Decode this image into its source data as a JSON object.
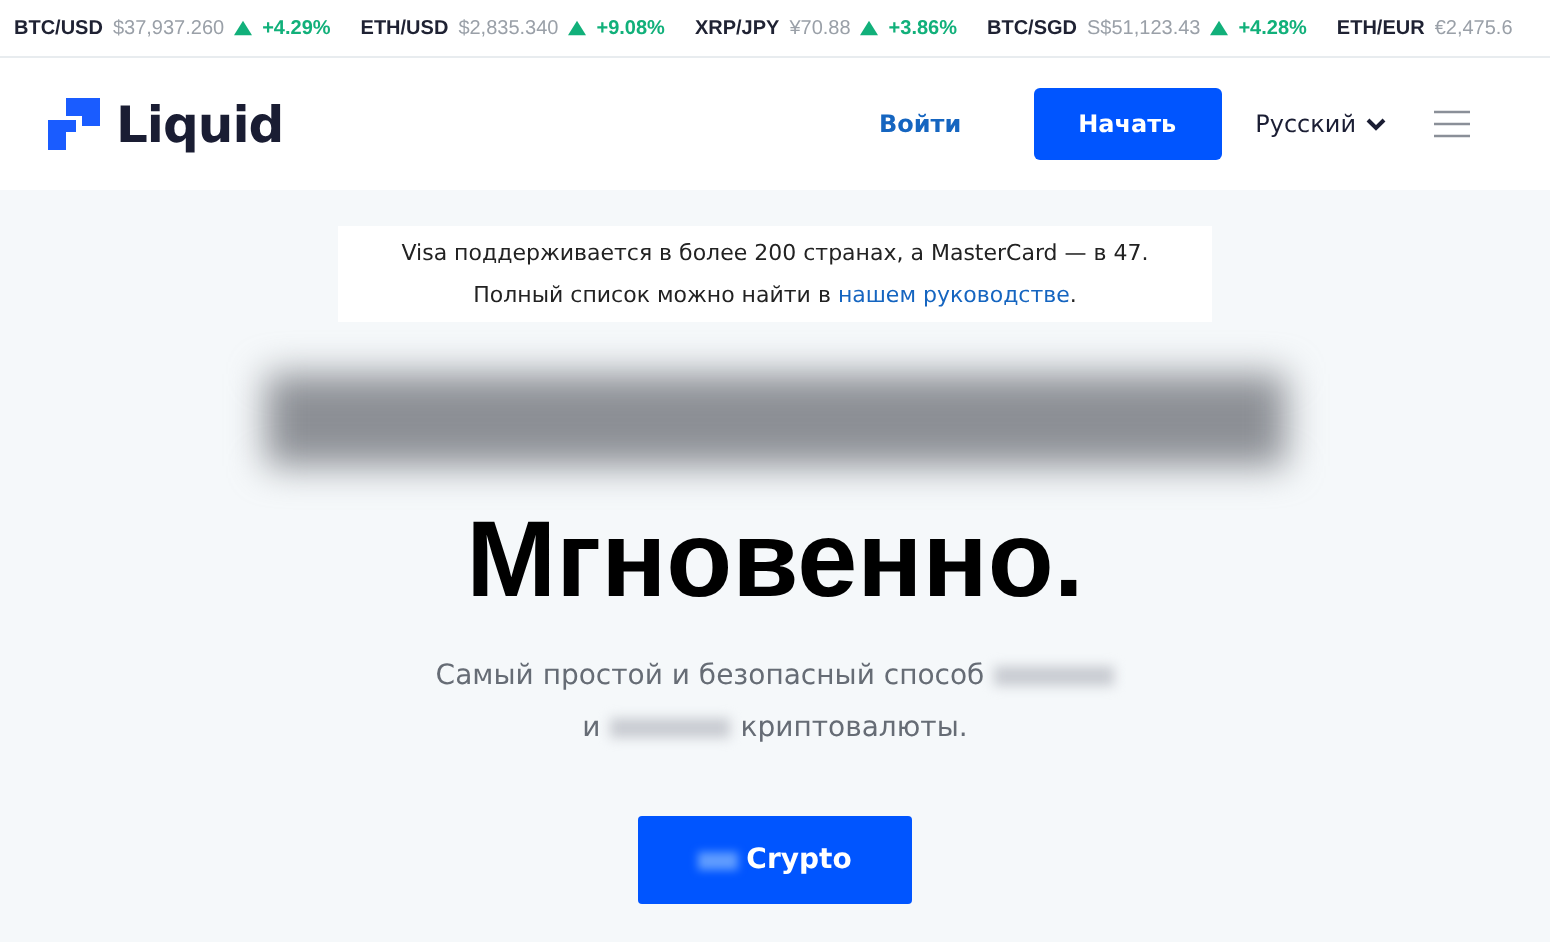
{
  "ticker": [
    {
      "pair": "BTC/USD",
      "price": "$37,937.260",
      "rising": true,
      "change": "+4.29%"
    },
    {
      "pair": "ETH/USD",
      "price": "$2,835.340",
      "rising": true,
      "change": "+9.08%"
    },
    {
      "pair": "XRP/JPY",
      "price": "¥70.88",
      "rising": true,
      "change": "+3.86%"
    },
    {
      "pair": "BTC/SGD",
      "price": "S$51,123.43",
      "rising": true,
      "change": "+4.28%"
    },
    {
      "pair": "ETH/EUR",
      "price": "€2,475.6"
    }
  ],
  "header": {
    "logo": "Liquid",
    "login": "Войти",
    "start": "Начать",
    "language": "Русский"
  },
  "notice": {
    "lines": [
      [
        {
          "text": "Visa поддерживается в более 200 странах, а MasterCard — в 47.",
          "link": false
        }
      ],
      [
        {
          "text": "Полный список можно найти в ",
          "link": false
        },
        {
          "text": "нашем руководстве",
          "link": true
        },
        {
          "text": ".",
          "link": false
        }
      ]
    ]
  },
  "hero": {
    "heading": [
      [
        {
          "kind": "blurred"
        }
      ],
      [
        {
          "kind": "text",
          "text": "Мгновенно."
        }
      ]
    ],
    "subtitle": [
      [
        {
          "kind": "text",
          "text": "Самый простой и безопасный способ"
        },
        {
          "kind": "blurred"
        }
      ],
      [
        {
          "kind": "text",
          "text": "и"
        },
        {
          "kind": "blurred"
        },
        {
          "kind": "text",
          "text": "криптовалюты."
        }
      ]
    ],
    "button": [
      {
        "kind": "blurred"
      },
      {
        "kind": "text",
        "text": "Crypto"
      }
    ]
  }
}
